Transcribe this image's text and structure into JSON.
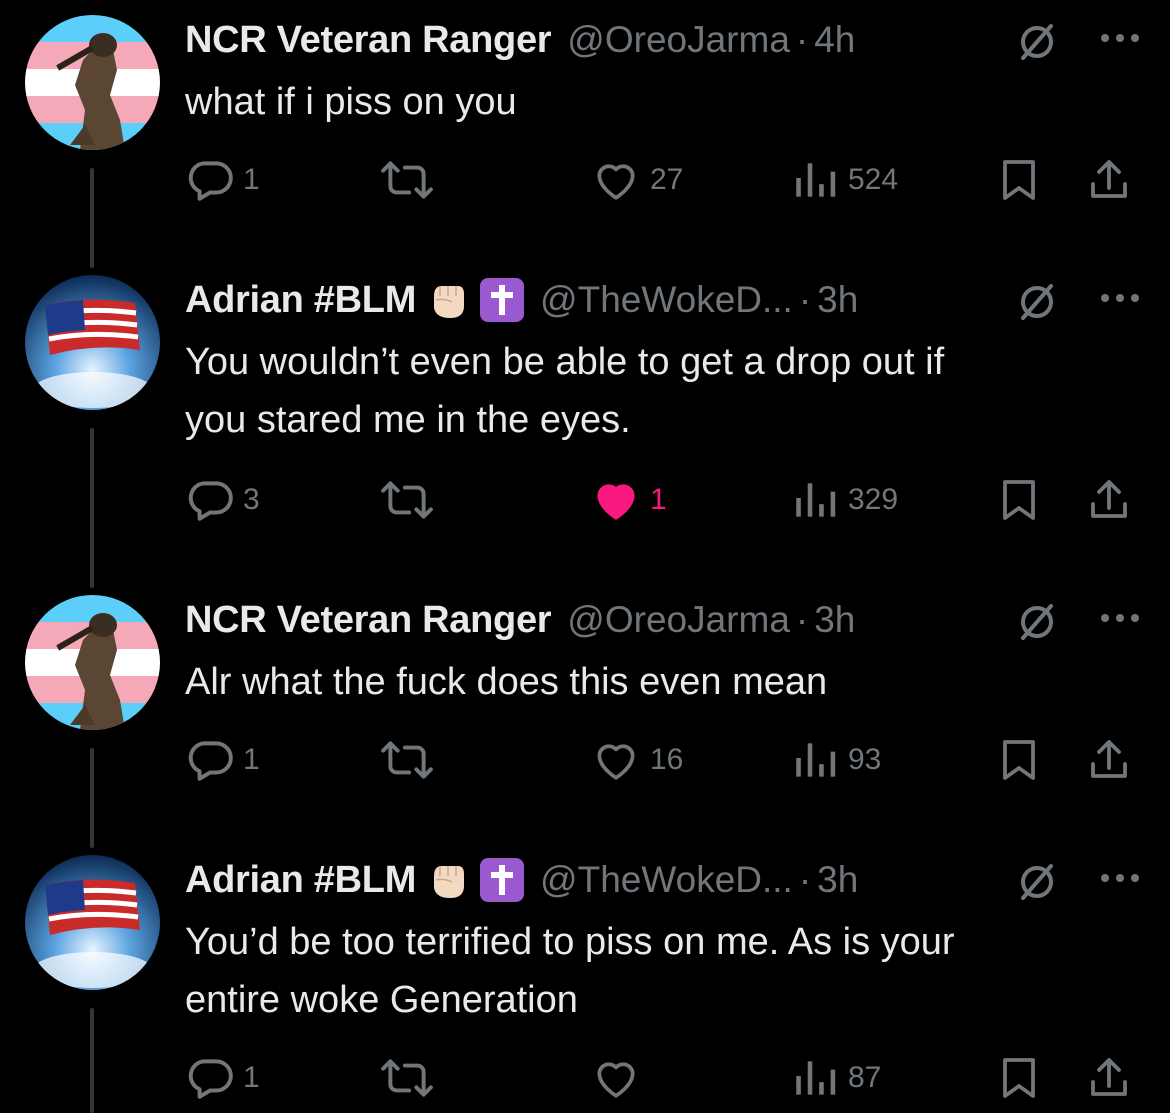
{
  "tweets": [
    {
      "name": "NCR Veteran Ranger",
      "handle": "@OreoJarma",
      "separator": "·",
      "time": "4h",
      "avatar": "ranger-avatar",
      "has_badges": false,
      "text_lines": [
        "what if i piss on you"
      ],
      "replies": "1",
      "retweets": "",
      "likes": "27",
      "liked": false,
      "views": "524"
    },
    {
      "name": "Adrian #BLM",
      "handle": "@TheWokeD...",
      "separator": "·",
      "time": "3h",
      "avatar": "flag-avatar",
      "has_badges": true,
      "badges": [
        "raised-fist-emoji",
        "latin-cross-emoji"
      ],
      "text_lines": [
        "You wouldn’t even be able to get a drop out if",
        "you stared me in the eyes."
      ],
      "replies": "3",
      "retweets": "",
      "likes": "1",
      "liked": true,
      "views": "329"
    },
    {
      "name": "NCR Veteran Ranger",
      "handle": "@OreoJarma",
      "separator": "·",
      "time": "3h",
      "avatar": "ranger-avatar",
      "has_badges": false,
      "text_lines": [
        "Alr what the fuck does this even mean"
      ],
      "replies": "1",
      "retweets": "",
      "likes": "16",
      "liked": false,
      "views": "93"
    },
    {
      "name": "Adrian #BLM",
      "handle": "@TheWokeD...",
      "separator": "·",
      "time": "3h",
      "avatar": "flag-avatar",
      "has_badges": true,
      "badges": [
        "raised-fist-emoji",
        "latin-cross-emoji"
      ],
      "text_lines": [
        "You’d be too terrified to piss on me. As is your",
        "entire woke Generation"
      ],
      "replies": "1",
      "retweets": "",
      "likes": "",
      "liked": false,
      "views": "87"
    }
  ],
  "colors": {
    "background": "#000000",
    "text": "#e7e9ea",
    "muted": "#71767b",
    "like_active": "#f91880",
    "thread_line": "#333639"
  }
}
